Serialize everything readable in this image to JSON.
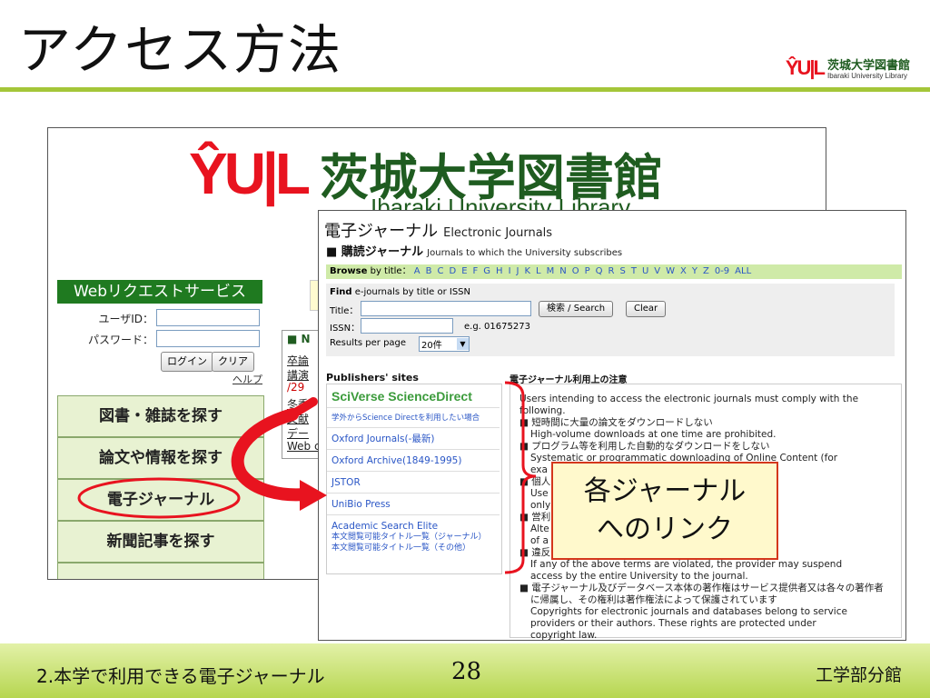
{
  "slide": {
    "title": "アクセス方法",
    "footer_left": "2.本学で利用できる電子ジャーナル",
    "footer_page": "28",
    "footer_right": "工学部分館"
  },
  "corner_logo": {
    "mark": "ŶU|L",
    "name_jp": "茨城大学図書館",
    "name_en": "Ibaraki University Library"
  },
  "library_site": {
    "logo_mark": "ŶU|L",
    "logo_jp": "茨城大学図書館",
    "logo_en": "Ibaraki University Library",
    "web_request_title": "Webリクエストサービス",
    "user_id_label": "ユーザID：",
    "password_label": "パスワード：",
    "login_button": "ログイン",
    "clear_button": "クリア",
    "help_link": "ヘルプ",
    "news_head": "■ N",
    "news_items": [
      "卒論",
      "講演",
      "/29",
      "冬季",
      "文献",
      "デー",
      "Web c"
    ],
    "nav": [
      "図書・雑誌を探す",
      "論文や情報を探す",
      "電子ジャーナル",
      "新聞記事を探す"
    ]
  },
  "ej_page": {
    "title": "電子ジャーナル",
    "title_en": "Electronic Journals",
    "subtitle": "■ 購読ジャーナル",
    "subtitle_en": "Journals to which the University subscribes",
    "browse_label": "Browse",
    "browse_by": "by title：",
    "letters": [
      "A",
      "B",
      "C",
      "D",
      "E",
      "F",
      "G",
      "H",
      "I",
      "J",
      "K",
      "L",
      "M",
      "N",
      "O",
      "P",
      "Q",
      "R",
      "S",
      "T",
      "U",
      "V",
      "W",
      "X",
      "Y",
      "Z",
      "0-9",
      "ALL"
    ],
    "find_label": "Find",
    "find_rest": "e-journals by title or ISSN",
    "title_field": "Title：",
    "search_button": "検索 / Search",
    "clear_button": "Clear",
    "issn_field": "ISSN：",
    "issn_example": "e.g. 01675273",
    "per_page_label": "Results per page",
    "per_page_value": "20件",
    "publishers_head": "Publishers' sites",
    "publishers": [
      "SciVerse ScienceDirect",
      "学外からScience Directを利用したい場合",
      "Oxford Journals(-最新)",
      "Oxford Archive(1849-1995)",
      "JSTOR",
      "UniBio Press",
      "Academic Search Elite",
      "本文閲覧可能タイトル一覧（ジャーナル）",
      "本文閲覧可能タイトル一覧（その他）"
    ],
    "notice_head": "電子ジャーナル利用上の注意",
    "notice_lines": [
      "Users intending to access the electronic journals must comply with the",
      "following.",
      "■ 短時間に大量の論文をダウンロードしない",
      "High-volume downloads at one time are prohibited.",
      "■ プログラム等を利用した自動的なダウンロードをしない",
      "Systematic or programmatic downloading of Online Content (for",
      "exa                                                  ted.",
      "■ 個人",
      "Use                                                  earch purposes",
      "only",
      "■ 営利",
      "Alte                                                  ng, republishing",
      "of a                                                  bited.",
      "■ 違反",
      "If any of the above terms are violated, the provider may suspend",
      "access by the entire University to the journal.",
      "■ 電子ジャーナル及びデータベース本体の著作権はサービス提供者又は各々の著作者",
      "に帰属し、その権利は著作権法によって保護されています",
      "Copyrights for electronic journals and databases belong to service",
      "providers or their authors. These rights are protected under",
      "copyright law."
    ]
  },
  "callout": {
    "line1": "各ジャーナル",
    "line2": "へのリンク"
  },
  "colors": {
    "accent_green": "#a4c639",
    "brand_green": "#1f5c20",
    "brand_red": "#e8131f",
    "annotation_red": "#e8131f"
  }
}
